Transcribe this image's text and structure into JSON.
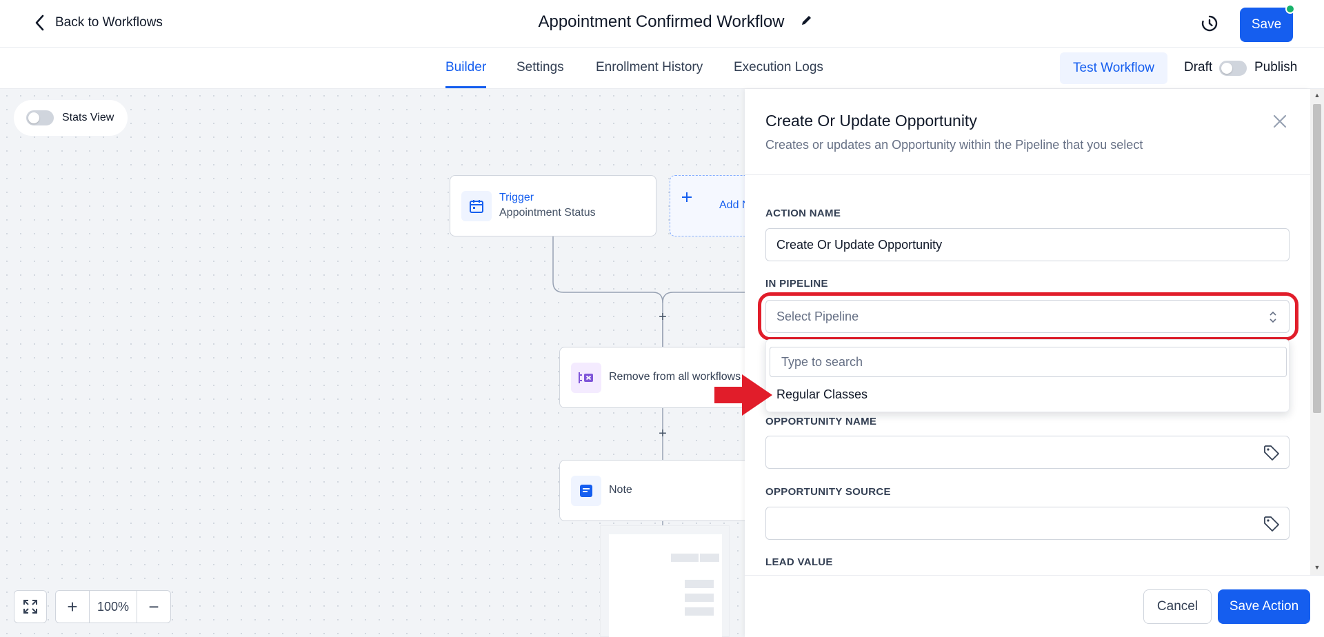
{
  "header": {
    "back_label": "Back to Workflows",
    "title": "Appointment Confirmed Workflow",
    "save_label": "Save"
  },
  "tabs": [
    {
      "label": "Builder",
      "active": true
    },
    {
      "label": "Settings"
    },
    {
      "label": "Enrollment History"
    },
    {
      "label": "Execution Logs"
    }
  ],
  "toolbar": {
    "test_label": "Test Workflow",
    "draft_label": "Draft",
    "publish_label": "Publish"
  },
  "canvas": {
    "stats_label": "Stats View",
    "trigger": {
      "title": "Trigger",
      "subtitle": "Appointment Status"
    },
    "add_new_label": "Add N",
    "remove_label": "Remove from all workflows",
    "note_label": "Note",
    "zoom_level": "100%"
  },
  "panel": {
    "title": "Create Or Update Opportunity",
    "subtitle": "Creates or updates an Opportunity within the Pipeline that you select",
    "action_name_label": "ACTION NAME",
    "action_name_value": "Create Or Update Opportunity",
    "pipeline_label": "IN PIPELINE",
    "pipeline_placeholder": "Select Pipeline",
    "search_placeholder": "Type to search",
    "pipeline_options": [
      "Regular Classes"
    ],
    "opportunity_name_label": "OPPORTUNITY NAME",
    "opportunity_source_label": "OPPORTUNITY SOURCE",
    "lead_value_label": "LEAD VALUE"
  },
  "footer": {
    "cancel_label": "Cancel",
    "save_action_label": "Save Action"
  },
  "colors": {
    "primary": "#155eef",
    "highlight": "#e11d2a",
    "status_dot": "#17b26a"
  }
}
